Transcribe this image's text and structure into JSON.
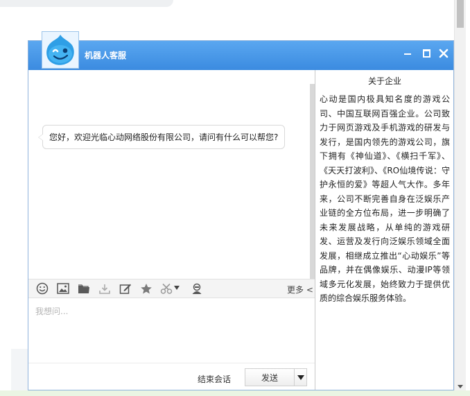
{
  "window": {
    "title": "机器人客服"
  },
  "chat": {
    "greeting": "您好，欢迎光临心动网络股份有限公司，请问有什么可以帮您?"
  },
  "toolbar": {
    "tools": [
      "smile-icon",
      "image-icon",
      "folder-icon",
      "download-icon",
      "edit-icon",
      "star-icon",
      "scissors-icon",
      "agent-icon"
    ],
    "more_label": "更多 <"
  },
  "input": {
    "placeholder": "我想问..."
  },
  "actions": {
    "end_session_label": "结束会话",
    "send_label": "发送"
  },
  "info_panel": {
    "title": "关于企业",
    "text": "心动是国内极具知名度的游戏公司、中国互联网百强企业。公司致力于网页游戏及手机游戏的研发与发行，是国内领先的游戏公司，旗下拥有《神仙道》、《横扫千军》、《天天打波利》、《RO仙境传说：守护永恒的爱》等超人气大作。多年来，公司不断完善自身在泛娱乐产业链的全方位布局，进一步明确了未来发展战略，从单纯的游戏研发、运营及发行向泛娱乐领域全面发展，相继成立推出“心动娱乐”等品牌，并在偶像娱乐、动漫IP等领域多元化发展，始终致力于提供优质的综合娱乐服务体验。"
  },
  "colors": {
    "title_bar": "#4a9ae8",
    "window_border": "#8fb3dc"
  }
}
